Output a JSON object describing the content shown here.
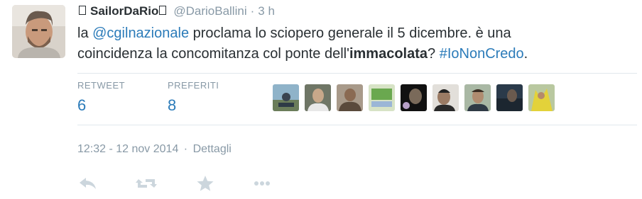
{
  "tweet": {
    "fullname": "SailorDaRio",
    "username": "@DarioBallini",
    "separator": "·",
    "time_ago": "3 h",
    "text_parts": {
      "p1": "la ",
      "mention": "@cgilnazionale",
      "p2": " proclama lo sciopero generale il 5 dicembre. è una coincidenza la concomitanza col ponte dell'",
      "bold": "immacolata",
      "p3": "? ",
      "hashtag": "#IoNonCredo",
      "p4": "."
    }
  },
  "stats": {
    "retweets_label": "RETWEET",
    "retweets_value": "6",
    "favorites_label": "PREFERITI",
    "favorites_value": "8"
  },
  "meta": {
    "timestamp": "12:32 - 12 nov 2014",
    "separator": "·",
    "details_label": "Dettagli"
  },
  "actions": {
    "icons": [
      "reply-icon",
      "retweet-icon",
      "favorite-star-icon",
      "more-icon"
    ]
  },
  "colors": {
    "link": "#2b7bb9",
    "muted": "#8899a6",
    "text": "#292f33",
    "divider": "#e1e8ed"
  }
}
